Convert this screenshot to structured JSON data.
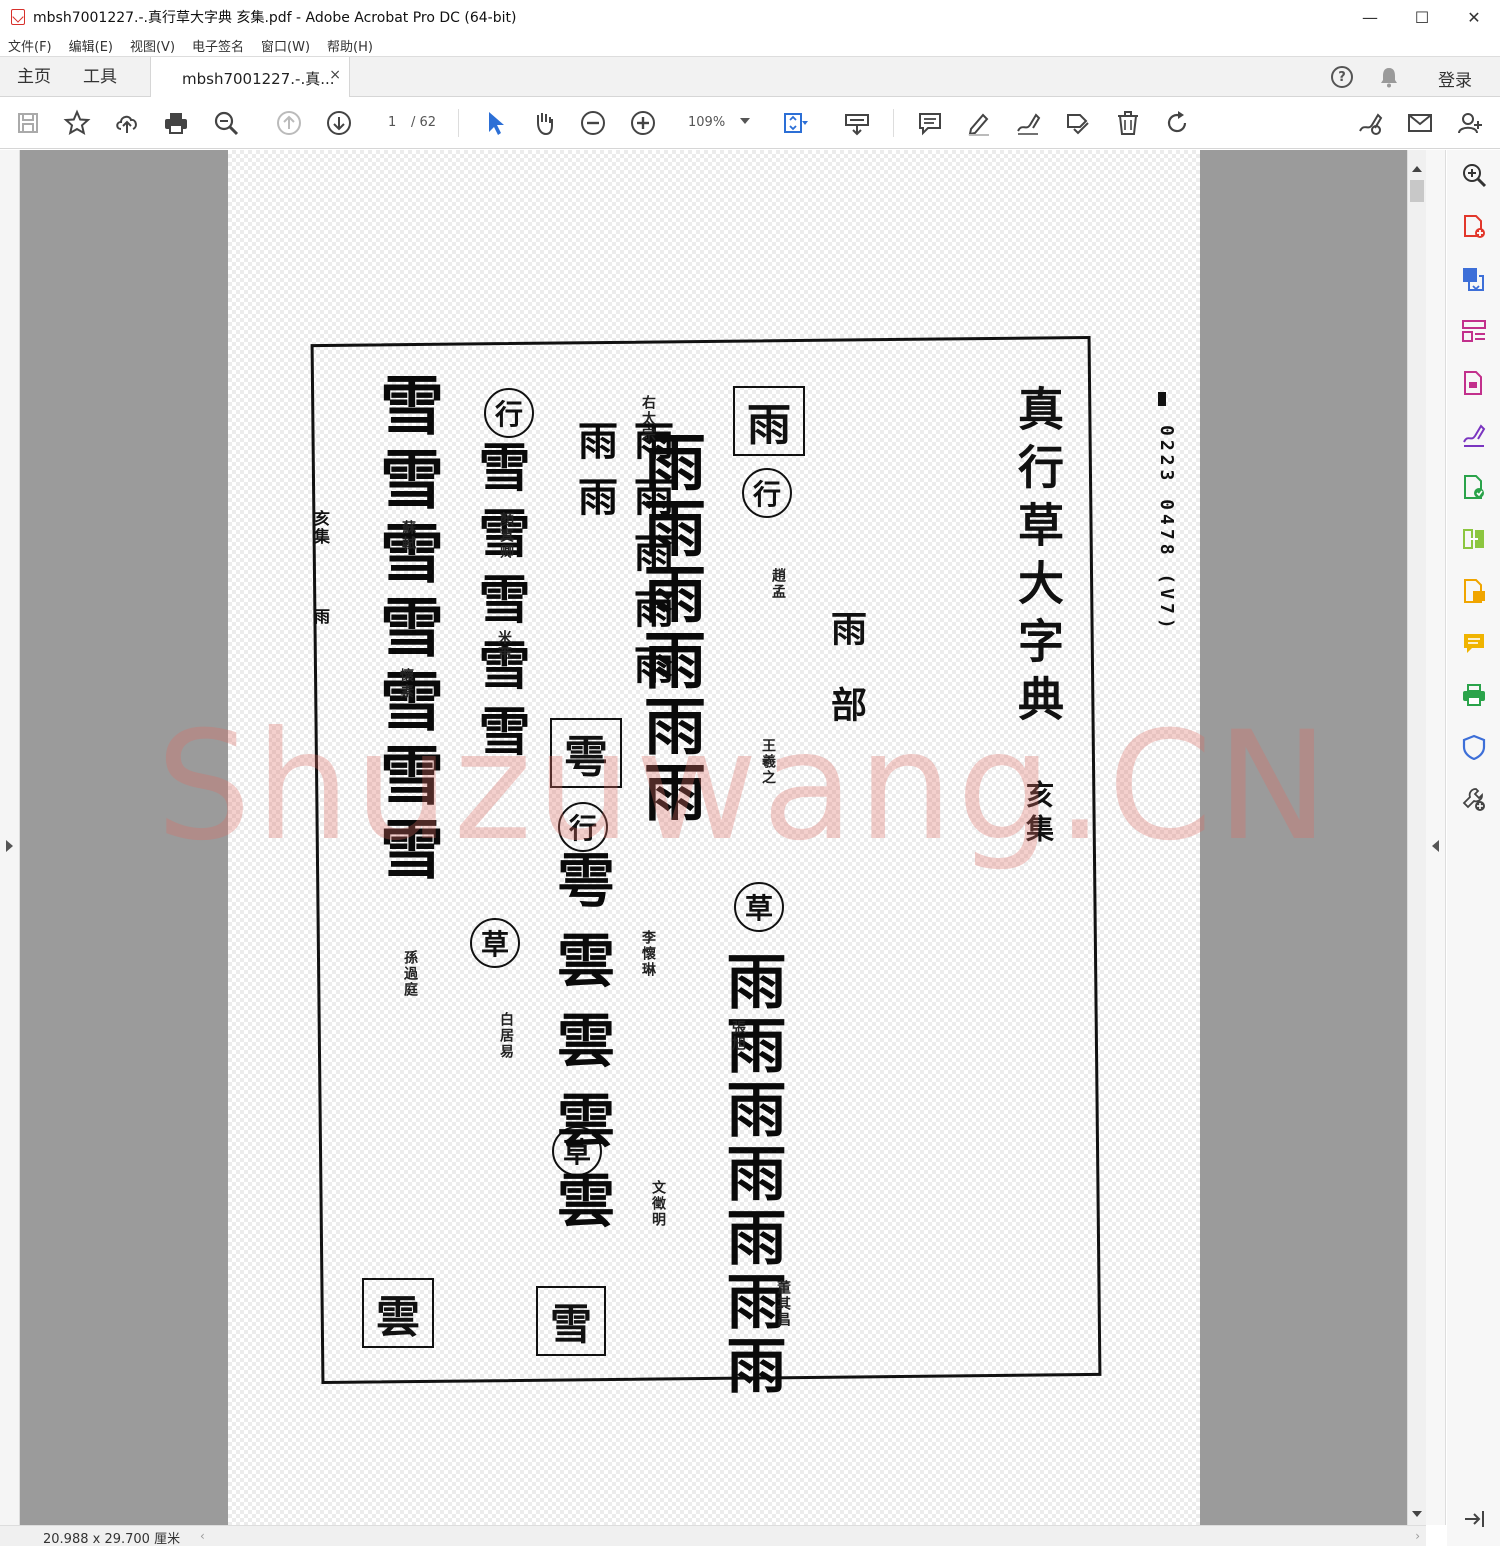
{
  "window": {
    "title": "mbsh7001227.-.真行草大字典 亥集.pdf - Adobe Acrobat Pro DC (64-bit)",
    "controls": {
      "minimize": "—",
      "maximize": "☐",
      "close": "✕"
    }
  },
  "menu": {
    "items": [
      "文件(F)",
      "编辑(E)",
      "视图(V)",
      "电子签名",
      "窗口(W)",
      "帮助(H)"
    ]
  },
  "tabs": {
    "home": "主页",
    "tools": "工具",
    "document": "mbsh7001227.-.真...",
    "close": "×",
    "help": "?",
    "login": "登录"
  },
  "toolbar": {
    "page_current": "1",
    "page_total": "/ 62",
    "zoom": "109%",
    "icons": [
      "save-icon",
      "bookmark-star-icon",
      "upload-cloud-icon",
      "print-icon",
      "zoom-search-icon",
      "page-up-icon",
      "page-down-icon",
      "select-arrow-icon",
      "hand-pan-icon",
      "zoom-out-icon",
      "zoom-in-icon",
      "fit-page-icon",
      "keyboard-icon",
      "comment-icon",
      "highlight-pen-icon",
      "draw-sign-icon",
      "stamp-icon",
      "delete-icon",
      "rotate-icon",
      "fill-sign-icon",
      "email-icon",
      "add-user-icon"
    ]
  },
  "document": {
    "book_title": "真行草大字典",
    "volume": "亥集",
    "radical": "雨部",
    "side_label_top": "亥集",
    "side_label_bottom": "雨",
    "boxed_chars": [
      "雨",
      "雩",
      "雪",
      "雲"
    ],
    "circled_labels": [
      "行",
      "行",
      "草",
      "草",
      "行",
      "草",
      "行"
    ],
    "columns": [
      "雨雨雨雨雨雨雨",
      "雨雨雨雨雨雨",
      "雨雨雨雨雨雨雨",
      "雩雲雲雲雲",
      "雪雪雪雪雪",
      "雪雪雪雪雪雪雪"
    ],
    "notes": [
      "右太宗",
      "趙孟",
      "王羲之",
      "張旭",
      "蘇軾",
      "董其昌",
      "文徵明",
      "顏真卿",
      "懷素",
      "孫過庭",
      "白居易",
      "米芾",
      "李懷琳"
    ],
    "margin_note": "0223 0478 (V7)",
    "watermark": "Shuzuwang.CN"
  },
  "status": {
    "dimensions": "20.988 x 29.700 厘米"
  },
  "right_panel": {
    "icons": [
      "zoom-panel-icon",
      "create-pdf-icon",
      "export-pdf-icon",
      "organize-pages-icon",
      "edit-pdf-icon",
      "sign-icon",
      "export-convert-icon",
      "combine-icon",
      "compress-icon",
      "comment-panel-icon",
      "print-production-icon",
      "protect-icon",
      "more-tools-icon",
      "expand-panel-icon"
    ],
    "colors": [
      "#333333",
      "#e2372b",
      "#3d6fd8",
      "#c2308c",
      "#c2308c",
      "#7a35c0",
      "#2aa34a",
      "#8cc63f",
      "#f0a500",
      "#f0b400",
      "#2aa34a",
      "#3d6fd8",
      "#444444",
      "#444444"
    ]
  }
}
